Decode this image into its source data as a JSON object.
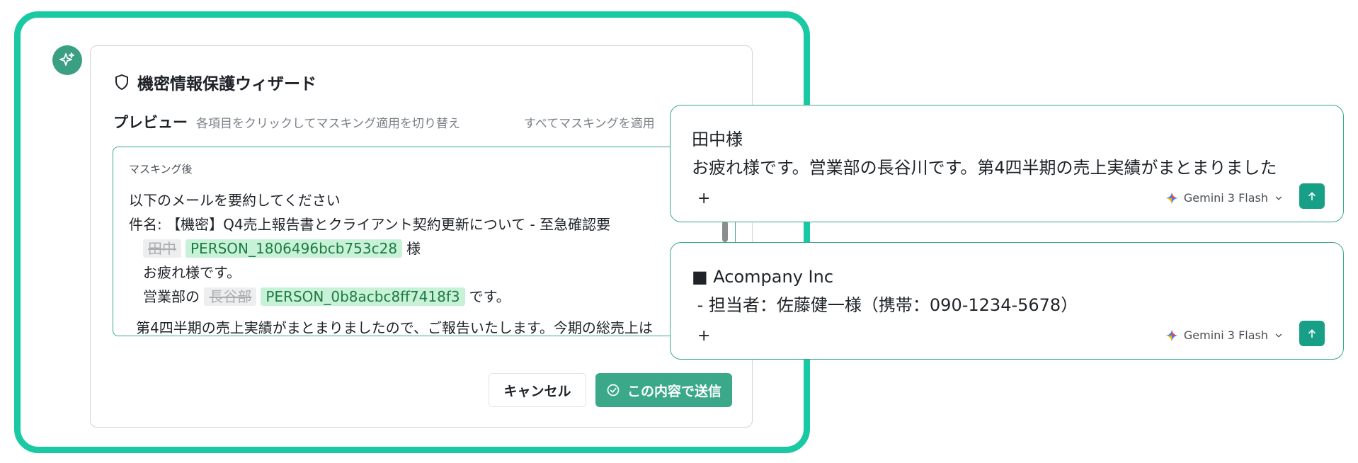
{
  "wizard": {
    "title": "機密情報保護ウィザード",
    "preview_label": "プレビュー",
    "preview_hint": "各項目をクリックしてマスキング適用を切り替え",
    "mask_all_label": "すべてマスキングを適用",
    "box_label": "マスキング後",
    "line1": "以下のメールを要約してください",
    "line2": "件名: 【機密】Q4売上報告書とクライアント契約更新について - 至急確認要",
    "name1_original": "田中",
    "name1_token": "PERSON_1806496bcb753c28",
    "name1_suffix": "様",
    "line4": "お疲れ様です。",
    "line5_prefix": "営業部の",
    "name2_original": "長谷部",
    "name2_token": "PERSON_0b8acbc8ff7418f3",
    "line5_suffix": "です。",
    "line6": "第4四半期の売上実績がまとまりましたので、ご報告いたします。今期の総売上は",
    "cancel_label": "キャンセル",
    "send_label": "この内容で送信"
  },
  "chat_cards": [
    {
      "lines": [
        "田中様",
        "お疲れ様です。営業部の長谷川です。第4四半期の売上実績がまとまりました"
      ],
      "plus": "+",
      "model": "Gemini 3 Flash"
    },
    {
      "lines": [
        "■ Acompany Inc",
        " - 担当者：佐藤健一様（携帯：090-1234-5678）"
      ],
      "plus": "+",
      "model": "Gemini 3 Flash"
    }
  ],
  "colors": {
    "accent": "#19c9a3",
    "primary": "#3aa889",
    "tag_bg": "#c8f2d8"
  }
}
